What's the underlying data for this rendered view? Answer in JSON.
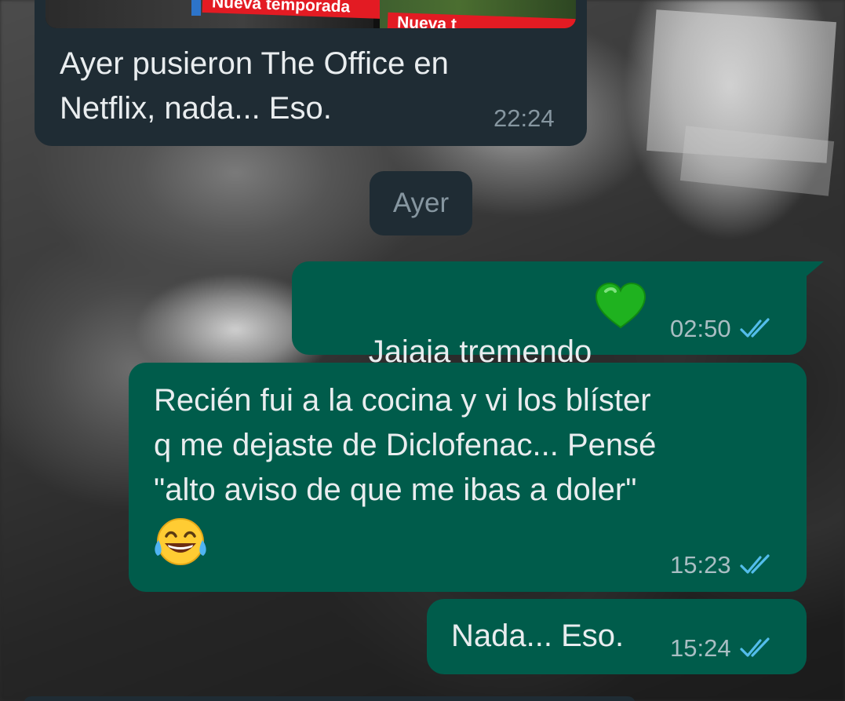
{
  "messages": [
    {
      "direction": "incoming",
      "preview_tags": [
        "Nueva temporada",
        "Nueva t"
      ],
      "text": "Ayer pusieron The Office en\nNetflix, nada... Eso.",
      "time": "22:24"
    },
    {
      "direction": "outgoing",
      "text": "Jajaja tremendo",
      "emoji": "green-heart-icon",
      "time": "02:50",
      "status": "read"
    },
    {
      "direction": "outgoing",
      "text": "Recién fui a la cocina y vi los blíster\nq me dejaste de Diclofenac... Pensé\n\"alto aviso de que me ibas a doler\"",
      "emoji": "laughing-tears-icon",
      "time": "15:23",
      "status": "read"
    },
    {
      "direction": "outgoing",
      "text": "Nada... Eso.",
      "time": "15:24",
      "status": "read"
    }
  ],
  "date_separator": "Ayer",
  "colors": {
    "incoming_bubble": "#1f2c34",
    "outgoing_bubble": "#005c4b",
    "read_ticks": "#53bdeb",
    "text": "#e9edef"
  }
}
